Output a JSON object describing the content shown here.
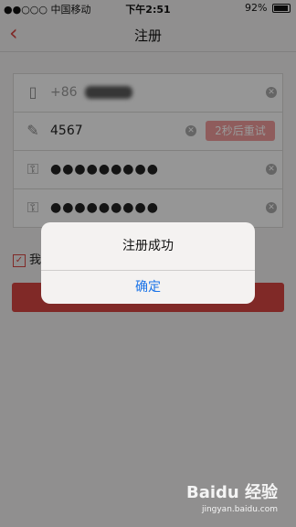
{
  "status_bar": {
    "carrier": "●●○○○ 中国移动",
    "time": "下午2:51",
    "battery_percent": "92%"
  },
  "nav": {
    "title": "注册"
  },
  "form": {
    "phone_prefix": "+86",
    "code_value": "4567",
    "retry_label": "2秒后重试",
    "password_mask": "●●●●●●●●●",
    "confirm_mask": "●●●●●●●●●"
  },
  "agree": {
    "label": "我"
  },
  "dialog": {
    "message": "注册成功",
    "confirm_label": "确定"
  },
  "watermark": {
    "logo": "Baidu 经验",
    "url": "jingyan.baidu.com"
  },
  "colors": {
    "accent": "#d64541",
    "link": "#1a73e8",
    "retry_bg": "#ef9a9a"
  }
}
